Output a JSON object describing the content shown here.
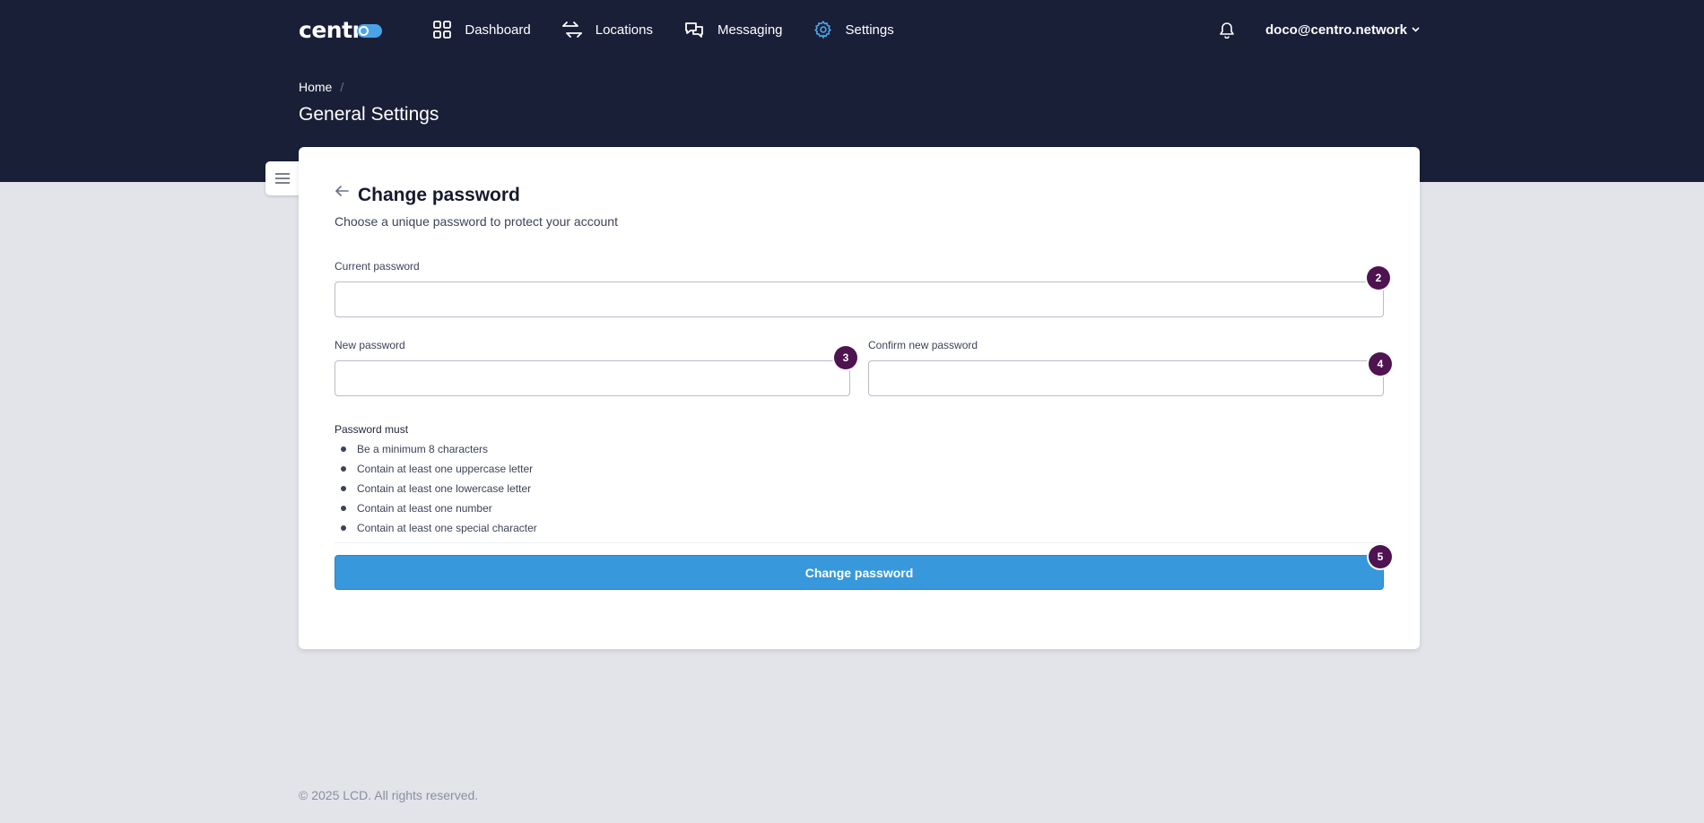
{
  "brand": {
    "name": "centr"
  },
  "nav": {
    "items": [
      {
        "label": "Dashboard",
        "icon": "grid-icon"
      },
      {
        "label": "Locations",
        "icon": "arrows-exchange-icon"
      },
      {
        "label": "Messaging",
        "icon": "chat-bubbles-icon"
      },
      {
        "label": "Settings",
        "icon": "gear-icon",
        "active": true
      }
    ],
    "user": "doco@centro.network"
  },
  "breadcrumb": {
    "home": "Home",
    "separator": "/"
  },
  "page": {
    "title": "General Settings"
  },
  "form": {
    "title": "Change password",
    "subtitle": "Choose a unique password to protect your account",
    "current_label": "Current password",
    "current_value": "",
    "new_label": "New password",
    "new_value": "",
    "confirm_label": "Confirm new password",
    "confirm_value": "",
    "rules_title": "Password must",
    "rules": [
      "Be a minimum 8 characters",
      "Contain at least one uppercase letter",
      "Contain at least one lowercase letter",
      "Contain at least one number",
      "Contain at least one special character"
    ],
    "submit_label": "Change password"
  },
  "badges": {
    "current": "2",
    "new": "3",
    "confirm": "4",
    "submit": "5"
  },
  "colors": {
    "header_bg": "#1a1f38",
    "page_bg": "#e3e4e9",
    "accent": "#3798db",
    "active_icon": "#4aa3e8",
    "badge": "#4e1350"
  },
  "footer": {
    "copyright": "© 2025 LCD. All rights reserved."
  }
}
